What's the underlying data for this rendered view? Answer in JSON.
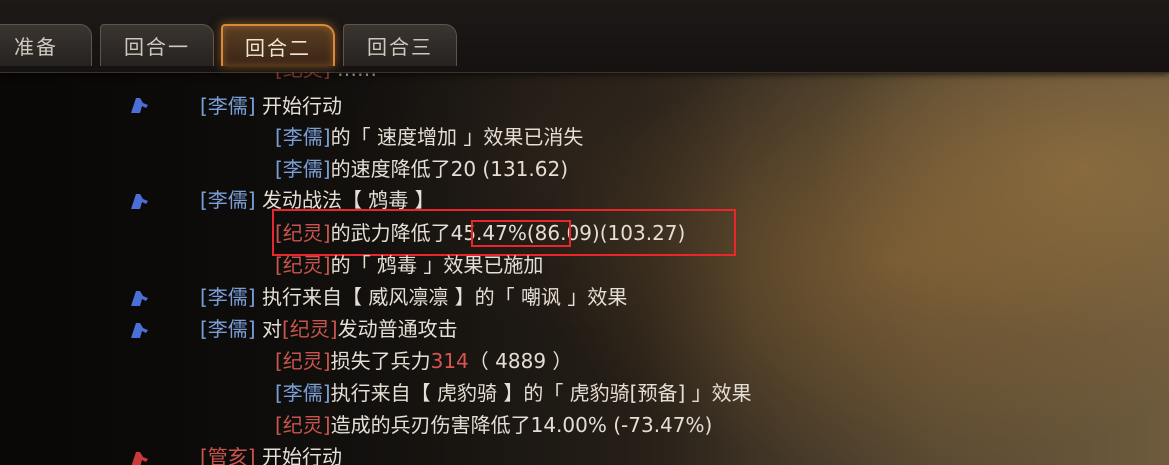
{
  "tabs": [
    {
      "label": "准备"
    },
    {
      "label": "回合一"
    },
    {
      "label": "回合二",
      "active": true
    },
    {
      "label": "回合三"
    }
  ],
  "log": {
    "l1": {
      "general": "[李儒]",
      "text": " 开始行动"
    },
    "l2": {
      "general": "[李儒]",
      "text": "的「 速度增加 」效果已消失"
    },
    "l3": {
      "general": "[李儒]",
      "text": "的速度降低了20 (131.62)"
    },
    "l4": {
      "general": "[李儒]",
      "text": " 发动战法【 鸩毒 】"
    },
    "l5": {
      "target": "[纪灵]",
      "pre": "的武力降低了",
      "pct": "45.47%",
      "post": "(86.09)(103.27)"
    },
    "l6": {
      "target": "[纪灵]",
      "text": "的「 鸩毒 」效果已施加"
    },
    "l7": {
      "general": "[李儒]",
      "text": " 执行来自【 威风凛凛 】的「 嘲讽 」效果"
    },
    "l8": {
      "general": "[李儒]",
      "pre": " 对",
      "target": "[纪灵]",
      "text": "发动普通攻击"
    },
    "l9": {
      "target": "[纪灵]",
      "pre": "损失了兵力",
      "num": "314",
      "post": "（ 4889 ）"
    },
    "l10": {
      "general": "[李儒]",
      "text": "执行来自【 虎豹骑 】的「 虎豹骑[预备] 」效果"
    },
    "l11": {
      "target": "[纪灵]",
      "text": "造成的兵刃伤害降低了14.00% (-73.47%)"
    },
    "l12": {
      "enemy": "[管亥]",
      "text": " 开始行动"
    }
  },
  "colors": {
    "ally_name": "#7a9fd8",
    "enemy_name": "#c9554f",
    "active_tab_border": "#d88a3a",
    "highlight_box": "#e8262c"
  },
  "icons": {
    "ally_action": "blue-horse-icon",
    "enemy_action": "red-horse-icon"
  }
}
